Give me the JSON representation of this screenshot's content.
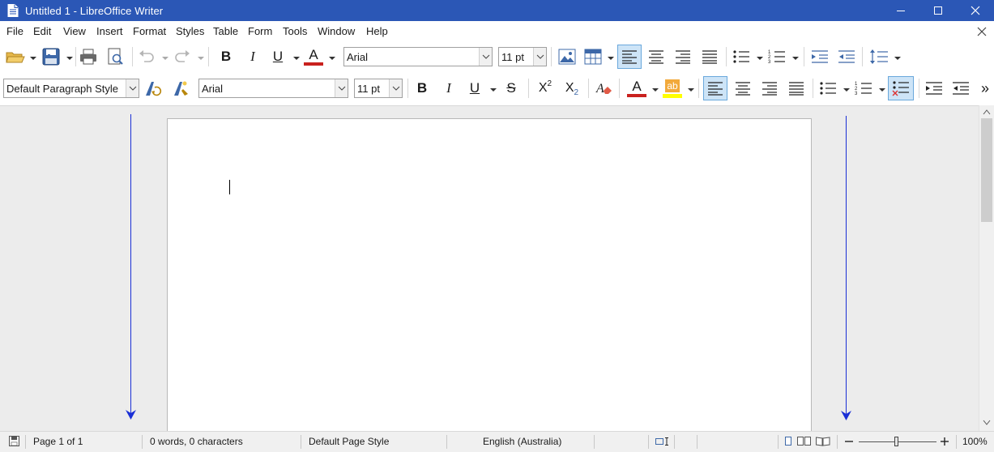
{
  "window": {
    "title": "Untitled 1 - LibreOffice Writer",
    "controls": [
      "minimize",
      "maximize",
      "close"
    ]
  },
  "menubar": {
    "items": [
      {
        "id": "file",
        "label": "File"
      },
      {
        "id": "edit",
        "label": "Edit"
      },
      {
        "id": "view",
        "label": "View"
      },
      {
        "id": "insert",
        "label": "Insert"
      },
      {
        "id": "format",
        "label": "Format"
      },
      {
        "id": "styles",
        "label": "Styles"
      },
      {
        "id": "table",
        "label": "Table"
      },
      {
        "id": "form",
        "label": "Form"
      },
      {
        "id": "tools",
        "label": "Tools"
      },
      {
        "id": "window",
        "label": "Window"
      },
      {
        "id": "help",
        "label": "Help"
      }
    ]
  },
  "standard_toolbar": {
    "font_name": "Arial",
    "font_size": "11 pt",
    "bold": "B",
    "italic": "I",
    "underline": "U",
    "font_color": "A",
    "font_color_value": "#c9211e",
    "align_left_active": true
  },
  "formatting_toolbar": {
    "paragraph_style": "Default Paragraph Style",
    "font_name": "Arial",
    "font_size": "11 pt",
    "bold": "B",
    "italic": "I",
    "underline": "U",
    "strikethrough": "S",
    "superscript": "X",
    "superscript_sup": "2",
    "subscript": "X",
    "subscript_sub": "2",
    "font_color": "A",
    "font_color_value": "#c9211e",
    "highlight_label": "ab",
    "highlight_color_value": "#ffff00",
    "align_left_active": true,
    "overflow": "»"
  },
  "document": {
    "text": ""
  },
  "statusbar": {
    "page": "Page 1 of 1",
    "word_count": "0 words, 0 characters",
    "page_style": "Default Page Style",
    "language": "English (Australia)",
    "zoom": "100%"
  },
  "colors": {
    "titlebar": "#2b57b6",
    "guide_arrows": "#1a2fd6",
    "doc_background": "#ececec"
  }
}
